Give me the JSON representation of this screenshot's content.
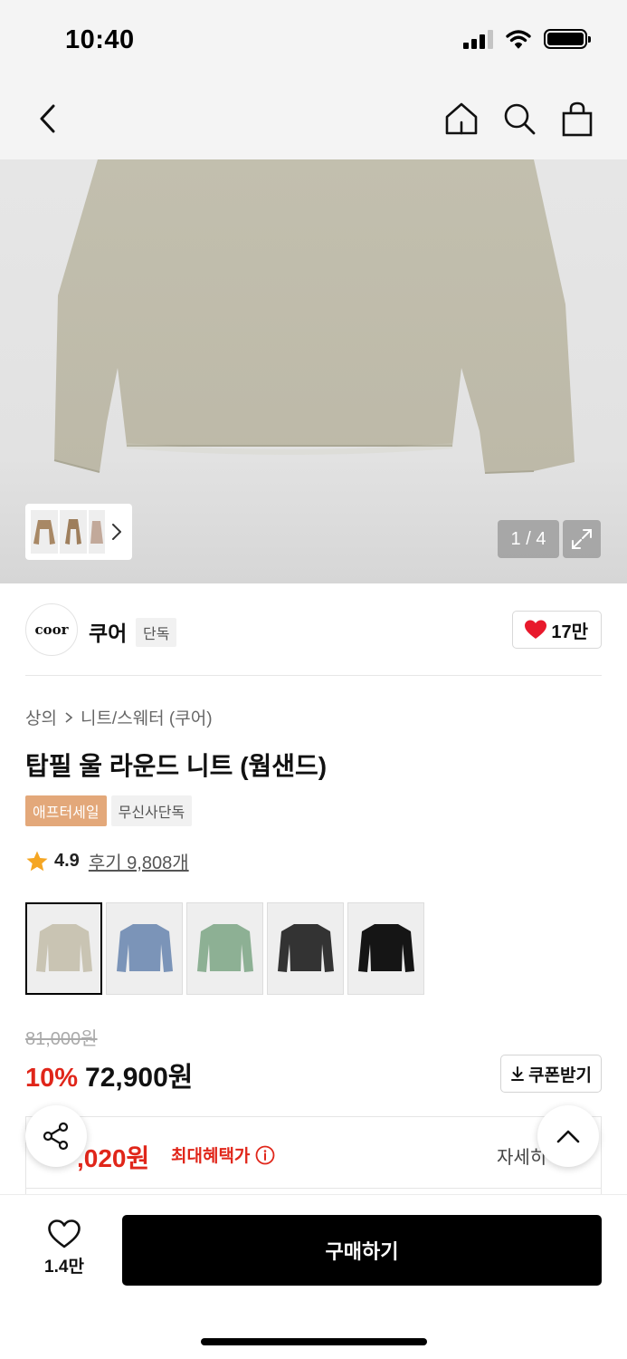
{
  "status_bar": {
    "time": "10:40"
  },
  "nav": {
    "back_icon": "chevron-left-icon",
    "home_icon": "home-icon",
    "search_icon": "search-icon",
    "cart_icon": "shopping-bag-icon"
  },
  "gallery": {
    "counter": "1 / 4",
    "thumbnail_count": 3,
    "expand_icon": "expand-icon"
  },
  "brand": {
    "logo_text": "coor",
    "name": "쿠어",
    "tag": "단독",
    "likes": "17만"
  },
  "product": {
    "breadcrumb": [
      "상의",
      "니트/스웨터 (쿠어)"
    ],
    "title": "탑필 울 라운드 니트 (웜샌드)",
    "tags": [
      "애프터세일",
      "무신사단독"
    ],
    "rating": "4.9",
    "reviews": "후기 9,808개"
  },
  "color_options": [
    {
      "name": "웜샌드",
      "color": "#c9c4b3",
      "selected": true
    },
    {
      "name": "blue",
      "color": "#7b94b8",
      "selected": false
    },
    {
      "name": "green",
      "color": "#8db094",
      "selected": false
    },
    {
      "name": "charcoal",
      "color": "#333333",
      "selected": false
    },
    {
      "name": "black",
      "color": "#151515",
      "selected": false
    }
  ],
  "price": {
    "original": "81,000원",
    "discount": "10%",
    "current": "72,900원",
    "coupon_label": "쿠폰받기"
  },
  "benefit": {
    "max_price": ",020원",
    "label": "최대혜택가",
    "detail": "자세히"
  },
  "bottom": {
    "wish_count": "1.4만",
    "buy_label": "구매하기"
  },
  "colors": {
    "accent_red": "#e0261a",
    "sale_tag": "#e3a87a",
    "heart": "#e8192c"
  }
}
